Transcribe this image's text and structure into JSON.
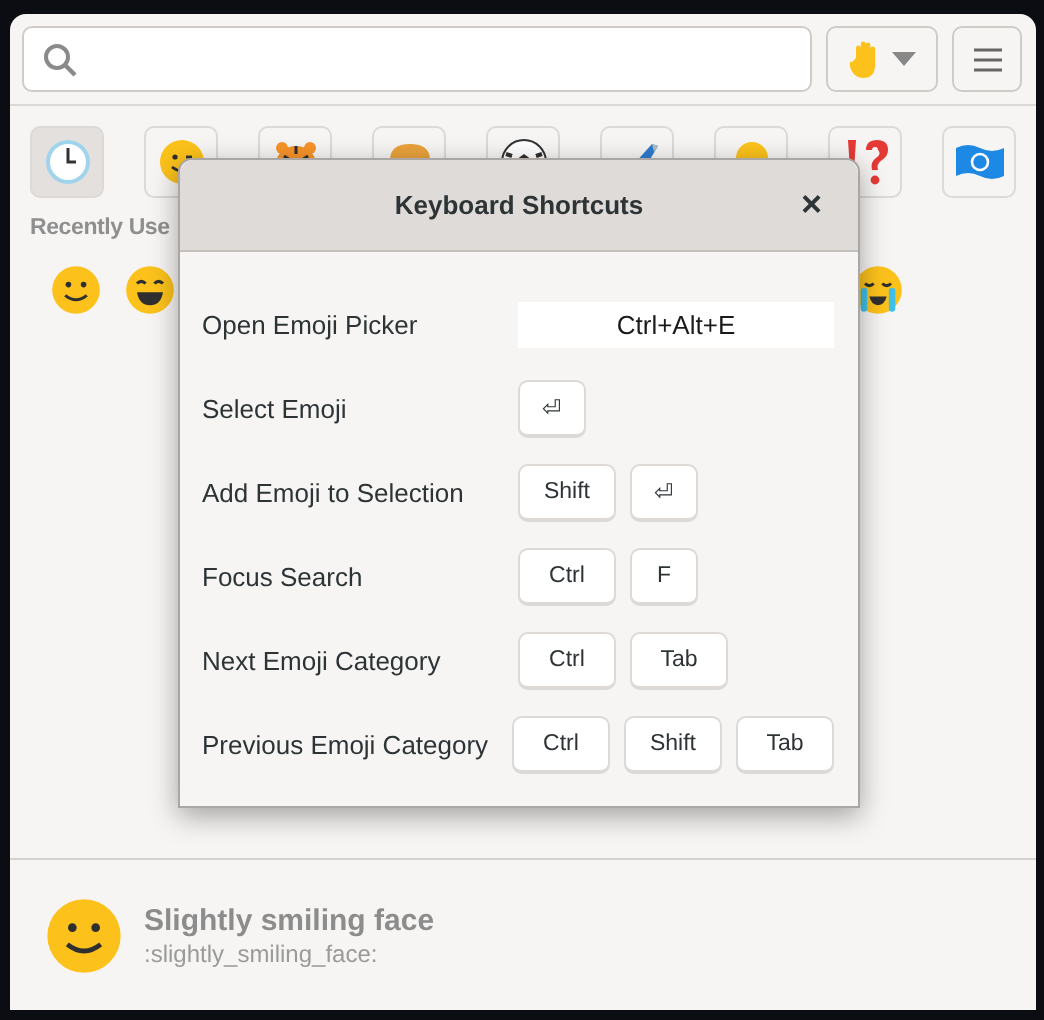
{
  "categories": [
    {
      "kind": "clock",
      "selected": true
    },
    {
      "kind": "smiley",
      "selected": false
    },
    {
      "kind": "tiger",
      "selected": false
    },
    {
      "kind": "burger",
      "selected": false
    },
    {
      "kind": "ball",
      "selected": false
    },
    {
      "kind": "plane",
      "selected": false
    },
    {
      "kind": "bulb",
      "selected": false
    },
    {
      "kind": "interrobang",
      "selected": false
    },
    {
      "kind": "flag",
      "selected": false
    }
  ],
  "section_title": "Recently Use",
  "recent": [
    {
      "kind": "smile"
    },
    {
      "kind": "grin"
    },
    {
      "kind": "cry"
    }
  ],
  "dialog": {
    "title": "Keyboard Shortcuts",
    "close": "×",
    "shortcuts": [
      {
        "label": "Open Emoji Picker",
        "kind": "field",
        "value": "Ctrl+Alt+E"
      },
      {
        "label": "Select Emoji",
        "kind": "keys",
        "keys": [
          "⏎"
        ]
      },
      {
        "label": "Add Emoji to Selection",
        "kind": "keys",
        "keys": [
          "Shift",
          "⏎"
        ]
      },
      {
        "label": "Focus Search",
        "kind": "keys",
        "keys": [
          "Ctrl",
          "F"
        ]
      },
      {
        "label": "Next Emoji Category",
        "kind": "keys",
        "keys": [
          "Ctrl",
          "Tab"
        ]
      },
      {
        "label": "Previous Emoji Category",
        "kind": "keys",
        "keys": [
          "Ctrl",
          "Shift",
          "Tab"
        ]
      }
    ]
  },
  "footer": {
    "name": "Slightly smiling face",
    "shortcode": ":slightly_smiling_face:"
  }
}
